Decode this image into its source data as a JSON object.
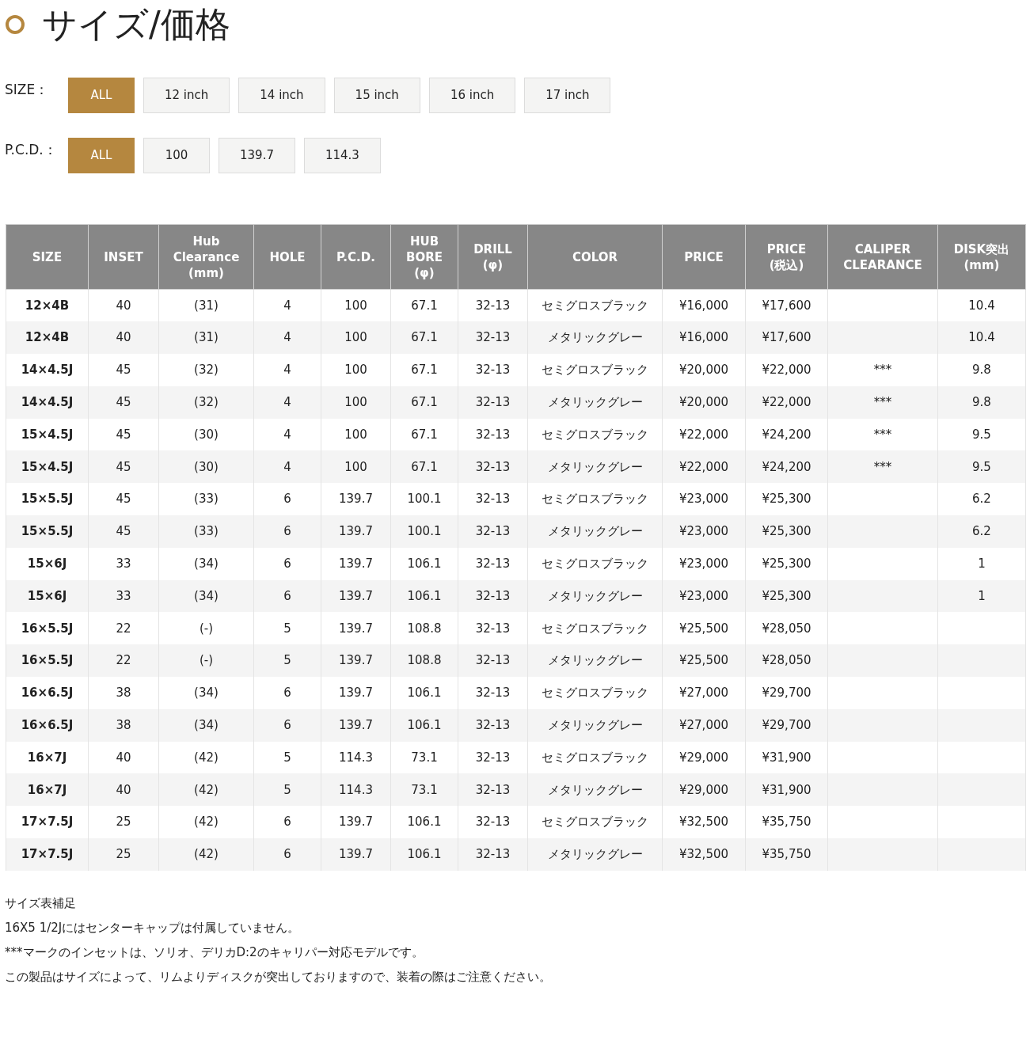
{
  "title": "サイズ/価格",
  "filters": [
    {
      "label": "SIZE：",
      "options": [
        {
          "label": "ALL",
          "selected": true
        },
        {
          "label": "12 inch",
          "selected": false
        },
        {
          "label": "14 inch",
          "selected": false
        },
        {
          "label": "15 inch",
          "selected": false
        },
        {
          "label": "16 inch",
          "selected": false
        },
        {
          "label": "17 inch",
          "selected": false
        }
      ]
    },
    {
      "label": "P.C.D.：",
      "options": [
        {
          "label": "ALL",
          "selected": true
        },
        {
          "label": "100",
          "selected": false
        },
        {
          "label": "139.7",
          "selected": false
        },
        {
          "label": "114.3",
          "selected": false
        }
      ]
    }
  ],
  "table": {
    "columns": [
      "SIZE",
      "INSET",
      "Hub\nClearance\n(mm)",
      "HOLE",
      "P.C.D.",
      "HUB\nBORE\n(φ)",
      "DRILL\n(φ)",
      "COLOR",
      "PRICE",
      "PRICE\n(税込)",
      "CALIPER\nCLEARANCE",
      "DISK突出\n(mm)"
    ],
    "rows": [
      [
        "12×4B",
        "40",
        "(31)",
        "4",
        "100",
        "67.1",
        "32-13",
        "セミグロスブラック",
        "¥16,000",
        "¥17,600",
        "",
        "10.4"
      ],
      [
        "12×4B",
        "40",
        "(31)",
        "4",
        "100",
        "67.1",
        "32-13",
        "メタリックグレー",
        "¥16,000",
        "¥17,600",
        "",
        "10.4"
      ],
      [
        "14×4.5J",
        "45",
        "(32)",
        "4",
        "100",
        "67.1",
        "32-13",
        "セミグロスブラック",
        "¥20,000",
        "¥22,000",
        "***",
        "9.8"
      ],
      [
        "14×4.5J",
        "45",
        "(32)",
        "4",
        "100",
        "67.1",
        "32-13",
        "メタリックグレー",
        "¥20,000",
        "¥22,000",
        "***",
        "9.8"
      ],
      [
        "15×4.5J",
        "45",
        "(30)",
        "4",
        "100",
        "67.1",
        "32-13",
        "セミグロスブラック",
        "¥22,000",
        "¥24,200",
        "***",
        "9.5"
      ],
      [
        "15×4.5J",
        "45",
        "(30)",
        "4",
        "100",
        "67.1",
        "32-13",
        "メタリックグレー",
        "¥22,000",
        "¥24,200",
        "***",
        "9.5"
      ],
      [
        "15×5.5J",
        "45",
        "(33)",
        "6",
        "139.7",
        "100.1",
        "32-13",
        "セミグロスブラック",
        "¥23,000",
        "¥25,300",
        "",
        "6.2"
      ],
      [
        "15×5.5J",
        "45",
        "(33)",
        "6",
        "139.7",
        "100.1",
        "32-13",
        "メタリックグレー",
        "¥23,000",
        "¥25,300",
        "",
        "6.2"
      ],
      [
        "15×6J",
        "33",
        "(34)",
        "6",
        "139.7",
        "106.1",
        "32-13",
        "セミグロスブラック",
        "¥23,000",
        "¥25,300",
        "",
        "1"
      ],
      [
        "15×6J",
        "33",
        "(34)",
        "6",
        "139.7",
        "106.1",
        "32-13",
        "メタリックグレー",
        "¥23,000",
        "¥25,300",
        "",
        "1"
      ],
      [
        "16×5.5J",
        "22",
        "(-)",
        "5",
        "139.7",
        "108.8",
        "32-13",
        "セミグロスブラック",
        "¥25,500",
        "¥28,050",
        "",
        ""
      ],
      [
        "16×5.5J",
        "22",
        "(-)",
        "5",
        "139.7",
        "108.8",
        "32-13",
        "メタリックグレー",
        "¥25,500",
        "¥28,050",
        "",
        ""
      ],
      [
        "16×6.5J",
        "38",
        "(34)",
        "6",
        "139.7",
        "106.1",
        "32-13",
        "セミグロスブラック",
        "¥27,000",
        "¥29,700",
        "",
        ""
      ],
      [
        "16×6.5J",
        "38",
        "(34)",
        "6",
        "139.7",
        "106.1",
        "32-13",
        "メタリックグレー",
        "¥27,000",
        "¥29,700",
        "",
        ""
      ],
      [
        "16×7J",
        "40",
        "(42)",
        "5",
        "114.3",
        "73.1",
        "32-13",
        "セミグロスブラック",
        "¥29,000",
        "¥31,900",
        "",
        ""
      ],
      [
        "16×7J",
        "40",
        "(42)",
        "5",
        "114.3",
        "73.1",
        "32-13",
        "メタリックグレー",
        "¥29,000",
        "¥31,900",
        "",
        ""
      ],
      [
        "17×7.5J",
        "25",
        "(42)",
        "6",
        "139.7",
        "106.1",
        "32-13",
        "セミグロスブラック",
        "¥32,500",
        "¥35,750",
        "",
        ""
      ],
      [
        "17×7.5J",
        "25",
        "(42)",
        "6",
        "139.7",
        "106.1",
        "32-13",
        "メタリックグレー",
        "¥32,500",
        "¥35,750",
        "",
        ""
      ]
    ]
  },
  "notes": [
    "サイズ表補足",
    "16X5 1/2Jにはセンターキャップは付属していません。",
    "***マークのインセットは、ソリオ、デリカD:2のキャリパー対応モデルです。",
    "この製品はサイズによって、リムよりディスクが突出しておりますので、装着の際はご注意ください。"
  ]
}
